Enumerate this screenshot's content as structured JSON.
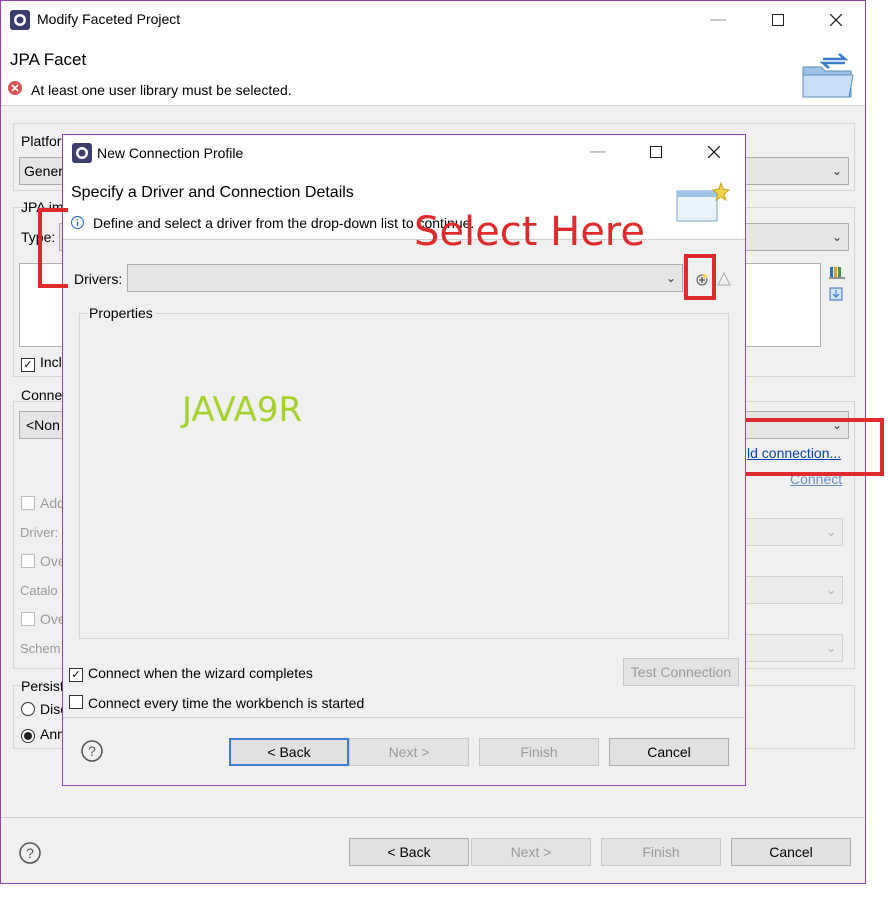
{
  "outer": {
    "title": "Modify Faceted Project",
    "header_title": "JPA Facet",
    "error_message": "At least one user library must be selected.",
    "platform_label": "Platfor",
    "platform_value": "Gener",
    "jpa_impl_label": "JPA im",
    "type_label": "Type:",
    "include_label": "Incl",
    "connection_label": "Conne",
    "connection_value": "<Non",
    "add_connection_link": "ld connection...",
    "connect_link": "Connect",
    "add_driver_label": "Add",
    "driver_label": "Driver:",
    "override_catalog_label": "Ove",
    "catalog_label": "Catalo",
    "override_schema_label": "Ove",
    "schema_label": "Schem",
    "persist_label": "Persist",
    "discover_label": "Disc",
    "annotated_label": "Ann",
    "buttons": {
      "back": "< Back",
      "next": "Next >",
      "finish": "Finish",
      "cancel": "Cancel"
    }
  },
  "inner": {
    "title": "New Connection Profile",
    "header_title": "Specify a Driver and Connection Details",
    "info_message": "Define and select a driver from the drop-down list to continue.",
    "drivers_label": "Drivers:",
    "properties_label": "Properties",
    "connect_when_complete": "Connect when the wizard completes",
    "connect_every_time": "Connect every time the workbench is started",
    "test_connection": "Test Connection",
    "buttons": {
      "back": "< Back",
      "next": "Next >",
      "finish": "Finish",
      "cancel": "Cancel"
    }
  },
  "annotations": {
    "select_here": "Select Here",
    "watermark": "JAVA9R"
  },
  "colors": {
    "annotation_red": "#e12a2a",
    "watermark_green": "#a6d22e",
    "window_border": "#8e44ad"
  }
}
